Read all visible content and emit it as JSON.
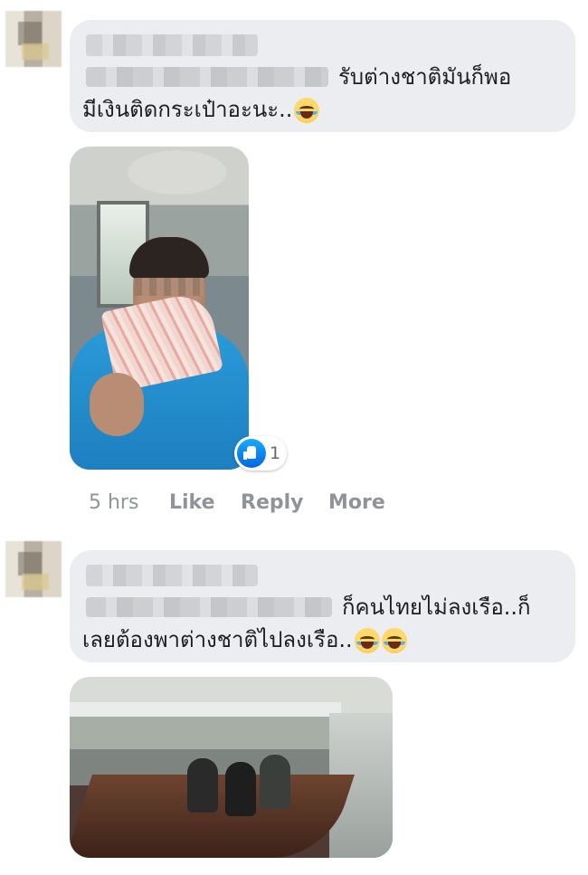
{
  "comment1": {
    "text_line1": "รับต่างชาติมันก็พอ",
    "text_line2": "มีเงินติดกระเป๋าอะนะ..",
    "emoji": [
      "tears-of-joy-emoji"
    ]
  },
  "reaction": {
    "icon": "thumbs-up-icon",
    "count": "1"
  },
  "actions": {
    "time": "5 hrs",
    "like": "Like",
    "reply": "Reply",
    "more": "More"
  },
  "comment2": {
    "text_line1": "ก็คนไทยไม่ลงเรือ..ก็",
    "text_line2": "เลยต้องพาต่างชาติไปลงเรือ..",
    "emoji": [
      "tears-of-joy-emoji",
      "tears-of-joy-emoji"
    ]
  },
  "colors": {
    "bubble": "#ebedf0",
    "like_blue": "#0165e1",
    "muted": "#8d949e"
  }
}
